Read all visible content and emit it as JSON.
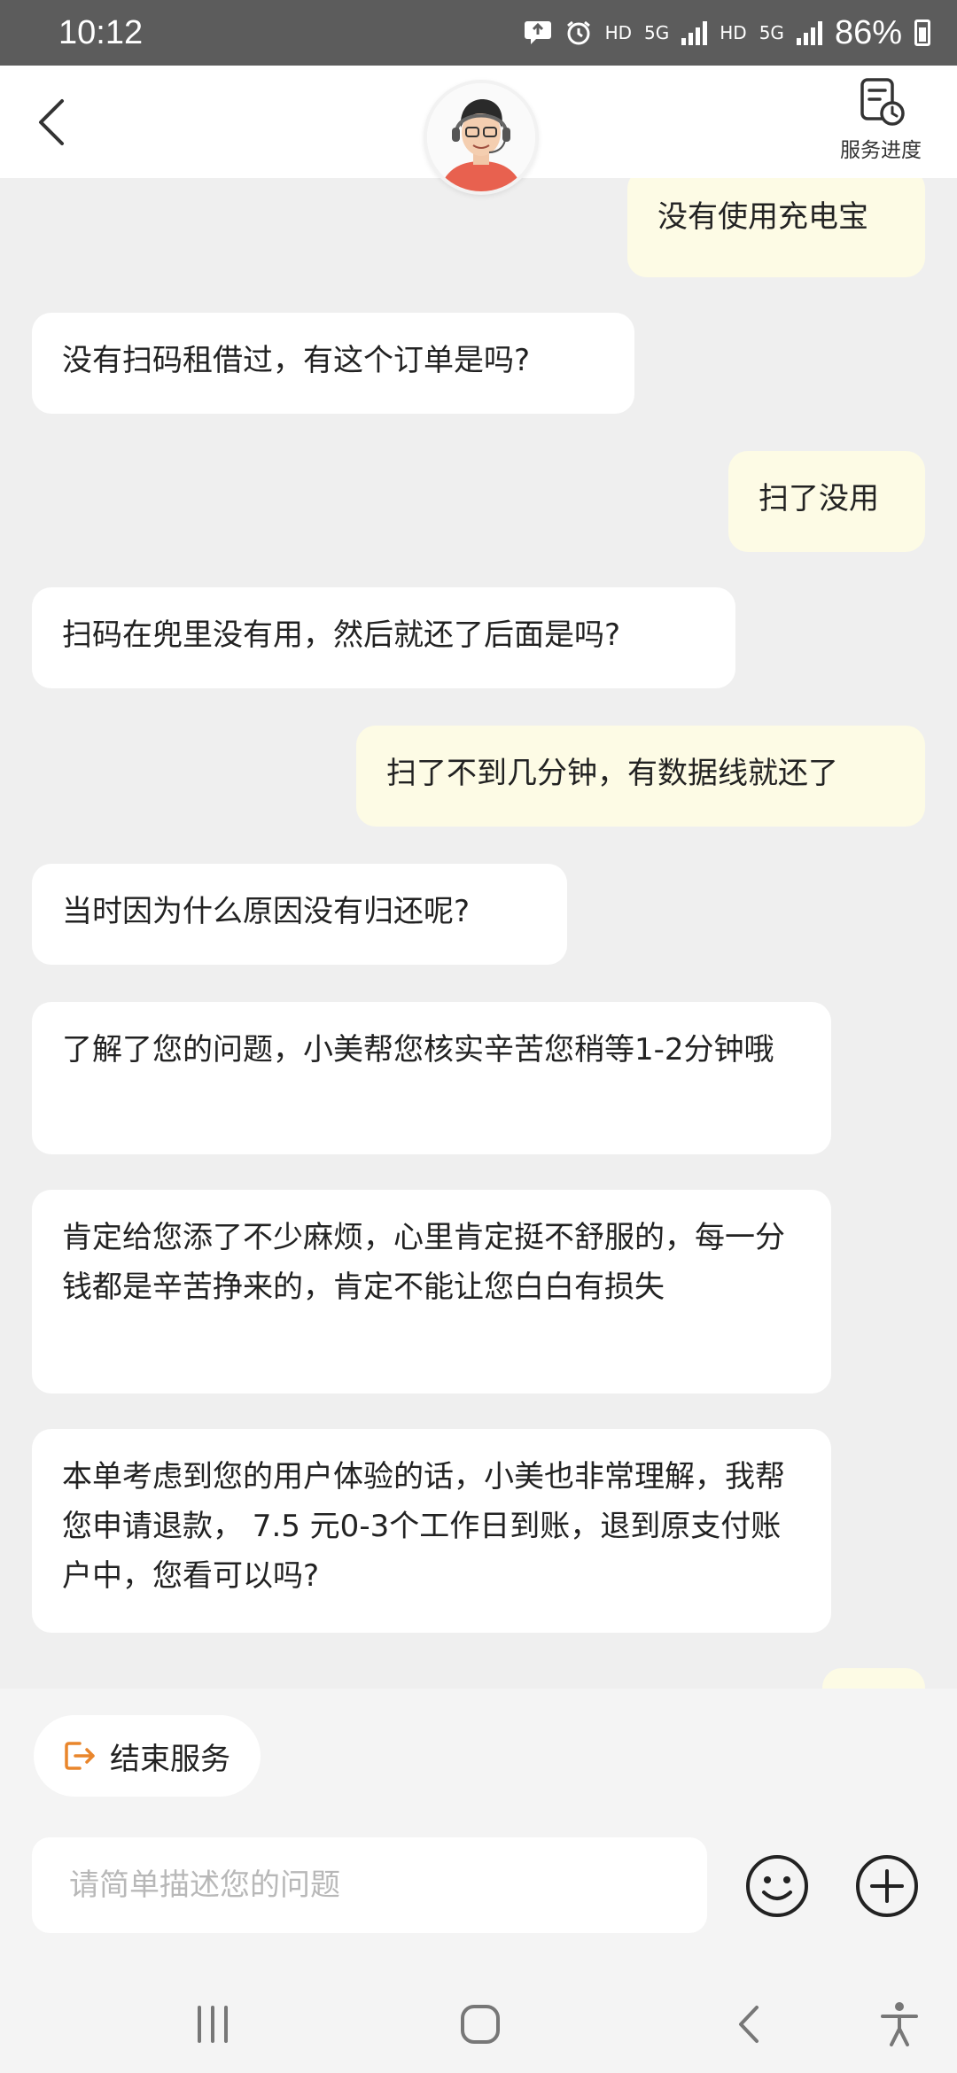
{
  "status_bar": {
    "time": "10:12",
    "hd1": "HD",
    "net1": "5G",
    "hd2": "HD",
    "net2": "5G",
    "battery": "86%"
  },
  "header": {
    "progress_label": "服务进度"
  },
  "messages": [
    {
      "sender": "user",
      "text": "没有使用充电宝"
    },
    {
      "sender": "agent",
      "text": "没有扫码租借过，有这个订单是吗?"
    },
    {
      "sender": "user",
      "text": "扫了没用"
    },
    {
      "sender": "agent",
      "text": "扫码在兜里没有用，然后就还了后面是吗?"
    },
    {
      "sender": "user",
      "text": "扫了不到几分钟，有数据线就还了"
    },
    {
      "sender": "agent",
      "text": "当时因为什么原因没有归还呢?"
    },
    {
      "sender": "agent",
      "text": "了解了您的问题，小美帮您核实辛苦您稍等1-2分钟哦"
    },
    {
      "sender": "agent",
      "text": "肯定给您添了不少麻烦，心里肯定挺不舒服的，每一分钱都是辛苦挣来的，肯定不能让您白白有损失"
    },
    {
      "sender": "agent",
      "text": "本单考虑到您的用户体验的话，小美也非常理解，我帮您申请退款，  7.5  元0-3个工作日到账，退到原支付账户中，您看可以吗?"
    }
  ],
  "bottom": {
    "end_service_label": "结束服务",
    "input_placeholder": "请简单描述您的问题"
  },
  "colors": {
    "user_bubble": "#fdfbe5",
    "agent_bubble": "#ffffff",
    "chat_background": "#efefef",
    "end_icon_accent": "#e9862c"
  }
}
